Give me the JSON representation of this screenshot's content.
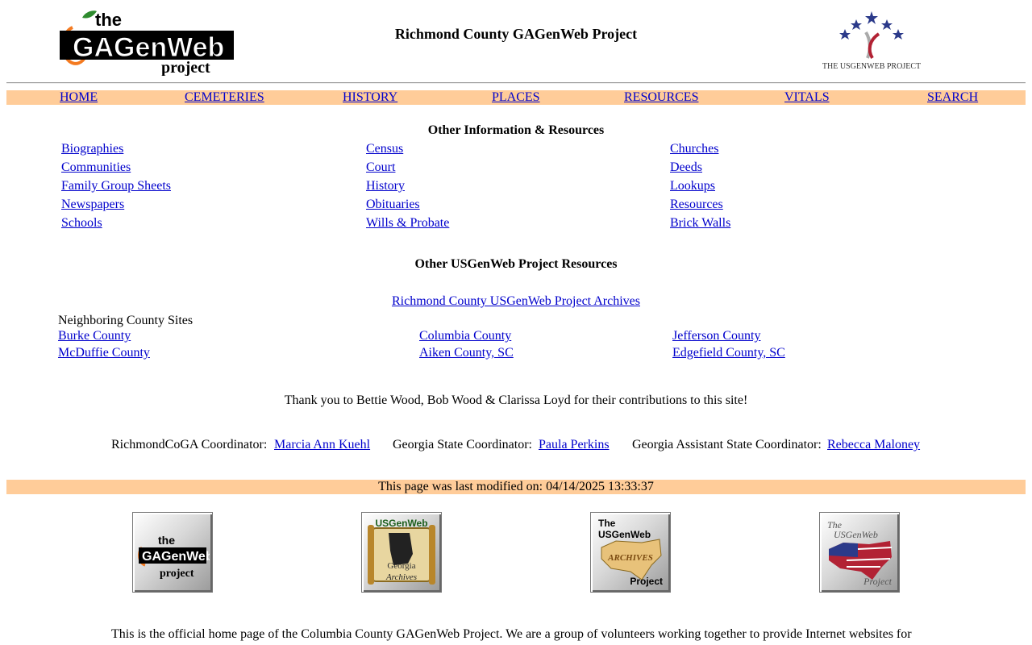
{
  "header": {
    "title": "Richmond County GAGenWeb Project",
    "ga_logo": {
      "line1": "the",
      "line2": "GAGenWeb",
      "line3": "project"
    },
    "us_logo": {
      "caption": "THE USGENWEB PROJECT"
    }
  },
  "nav": [
    {
      "label": "HOME"
    },
    {
      "label": "CEMETERIES"
    },
    {
      "label": "HISTORY"
    },
    {
      "label": "PLACES"
    },
    {
      "label": "RESOURCES"
    },
    {
      "label": "VITALS"
    },
    {
      "label": "SEARCH"
    }
  ],
  "other_info": {
    "title": "Other Information & Resources",
    "col1": [
      "Biographies",
      "Communities",
      "Family Group Sheets",
      "Newspapers",
      "Schools"
    ],
    "col2": [
      "Census",
      "Court",
      "History",
      "Obituaries",
      "Wills & Probate"
    ],
    "col3": [
      "Churches",
      "Deeds",
      "Lookups",
      "Resources",
      "Brick Walls"
    ]
  },
  "usgenweb": {
    "title": "Other USGenWeb Project Resources",
    "archives_link": "Richmond County USGenWeb Project Archives",
    "neighboring_label": "Neighboring County Sites",
    "neighbors": [
      "Burke County",
      "Columbia County",
      "Jefferson County",
      "McDuffie County",
      "Aiken County, SC",
      "Edgefield County, SC"
    ]
  },
  "thanks": "Thank you to Bettie Wood, Bob Wood & Clarissa Loyd for their contributions to this site!",
  "coordinators": {
    "county_label": "RichmondCoGA Coordinator:",
    "county_name": "Marcia Ann Kuehl",
    "state_label": "Georgia State Coordinator:",
    "state_name": "Paula Perkins",
    "assistant_label": "Georgia Assistant State Coordinator:",
    "assistant_name": "Rebecca Maloney"
  },
  "modified": "This page was last modified on: 04/14/2025 13:33:37",
  "badges": {
    "gagenweb": {
      "line1": "the",
      "line2": "GAGenWeb",
      "line3": "project"
    },
    "georgia": {
      "line1": "USGenWeb",
      "line2": "Georgia",
      "line3": "Archives"
    },
    "archives": {
      "line1": "The",
      "line2": "USGenWeb",
      "line3": "ARCHIVES",
      "line4": "Project"
    },
    "usgenweb": {
      "line1": "The",
      "line2": "USGenWeb",
      "line3": "Project"
    }
  },
  "footer": {
    "line1": "This is the official home page of the Columbia County GAGenWeb Project.  We are a group of volunteers working together to provide Internet websites for"
  },
  "colors": {
    "accent_bar": "#ffcc99",
    "link": "#0000cc",
    "peach": "#f47a20"
  }
}
